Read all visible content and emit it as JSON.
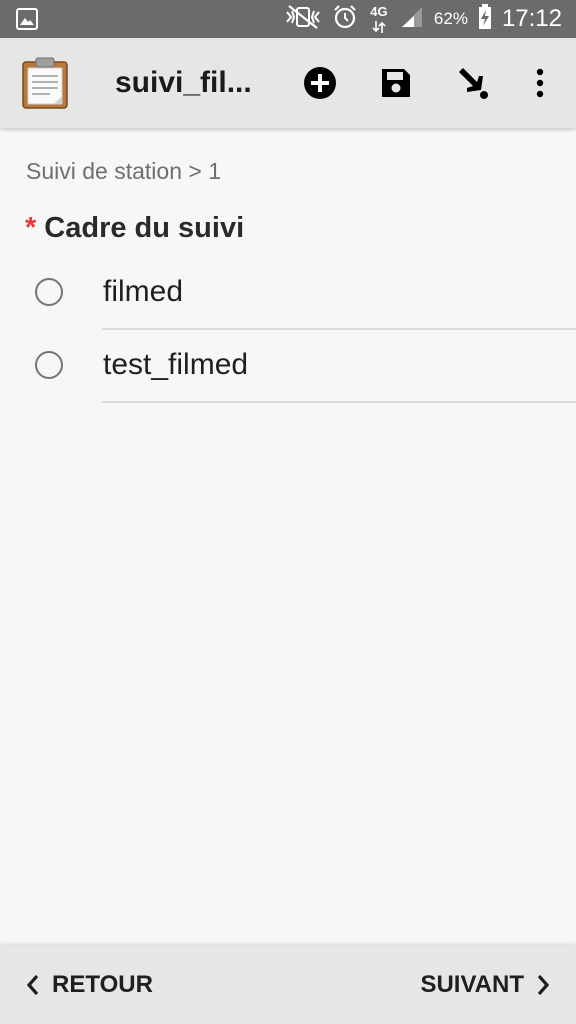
{
  "status_bar": {
    "battery_percent": "62%",
    "time": "17:12",
    "network": "4G"
  },
  "toolbar": {
    "title": "suivi_fil...",
    "actions": [
      "add-circle-icon",
      "save-icon",
      "jump-icon",
      "more-vert-icon"
    ]
  },
  "content": {
    "breadcrumb": "Suivi de station > 1",
    "required_marker": "*",
    "question": "Cadre du suivi",
    "options": [
      {
        "label": "filmed",
        "selected": false
      },
      {
        "label": "test_filmed",
        "selected": false
      }
    ]
  },
  "navigation": {
    "back_label": "RETOUR",
    "next_label": "SUIVANT"
  },
  "colors": {
    "status_bar_bg": "#6b6b6b",
    "app_bar_bg": "#e6e6e6",
    "page_bg": "#f7f7f7",
    "required": "#e53935",
    "text_primary": "#1f1f1f",
    "text_secondary": "#6f6f6f"
  }
}
